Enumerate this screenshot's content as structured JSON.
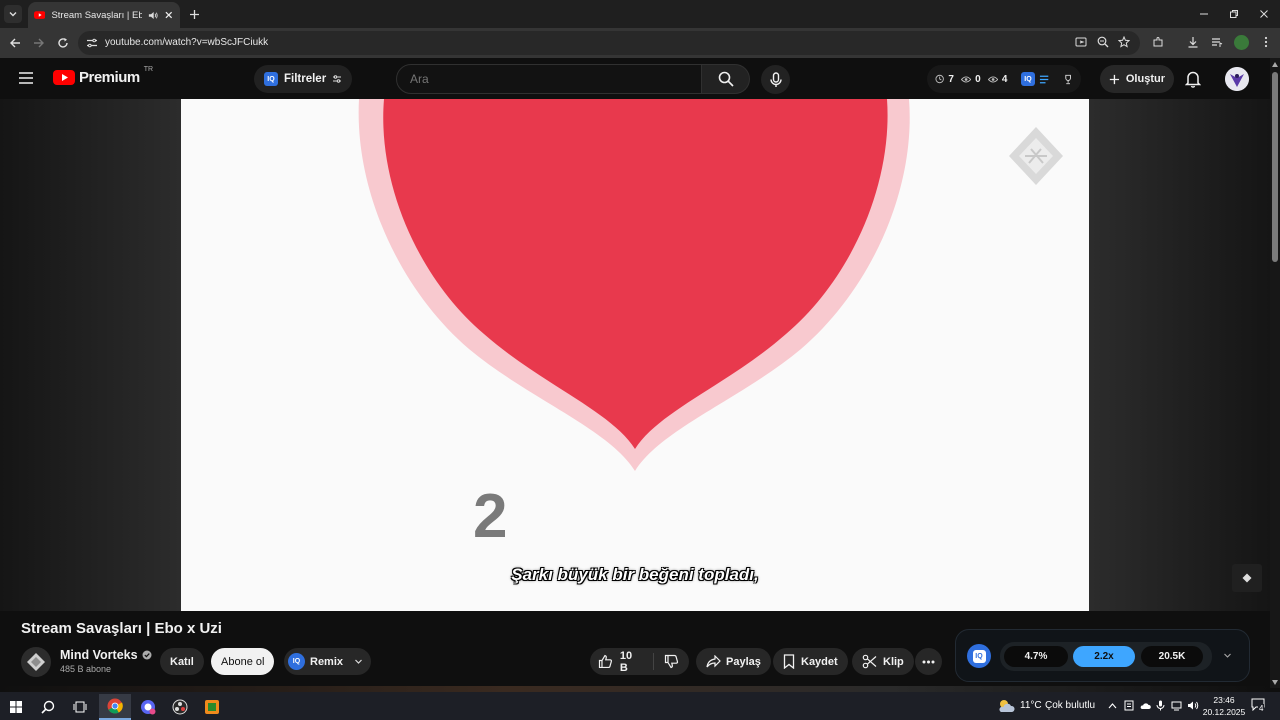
{
  "browser": {
    "tab_title": "Stream Savaşları | Ebo x Uzi",
    "url": "youtube.com/watch?v=wbScJFCiukk"
  },
  "header": {
    "logo_text": "Premium",
    "region": "TR",
    "filters_label": "Filtreler",
    "search_placeholder": "Ara",
    "stat_time": "7",
    "stat_views": "0",
    "stat_watch": "4",
    "create_label": "Oluştur"
  },
  "video": {
    "subtitle": "Şarkı büyük bir beğeni topladı,",
    "frame_digit": "2"
  },
  "meta": {
    "title": "Stream Savaşları | Ebo x Uzi",
    "channel_name": "Mind Vorteks",
    "subscribers": "485 B abone",
    "join_label": "Katıl",
    "subscribe_label": "Abone ol",
    "remix_label": "Remix",
    "likes": "10 B",
    "share_label": "Paylaş",
    "save_label": "Kaydet",
    "clip_label": "Klip"
  },
  "quality_bar": {
    "ratio": "4.7%",
    "speed": "2.2x",
    "count": "20.5K"
  },
  "taskbar": {
    "weather_temp": "11°C",
    "weather_desc": "Çok bulutlu",
    "time": "23:46",
    "date": "20.12.2025",
    "notification_count": "4"
  },
  "colors": {
    "heart": "#e8394d",
    "heart_outline": "#f8c9cf",
    "accent_blue": "#3ea6ff",
    "iq_blue": "#2f6fde",
    "youtube_red": "#ff0000"
  }
}
